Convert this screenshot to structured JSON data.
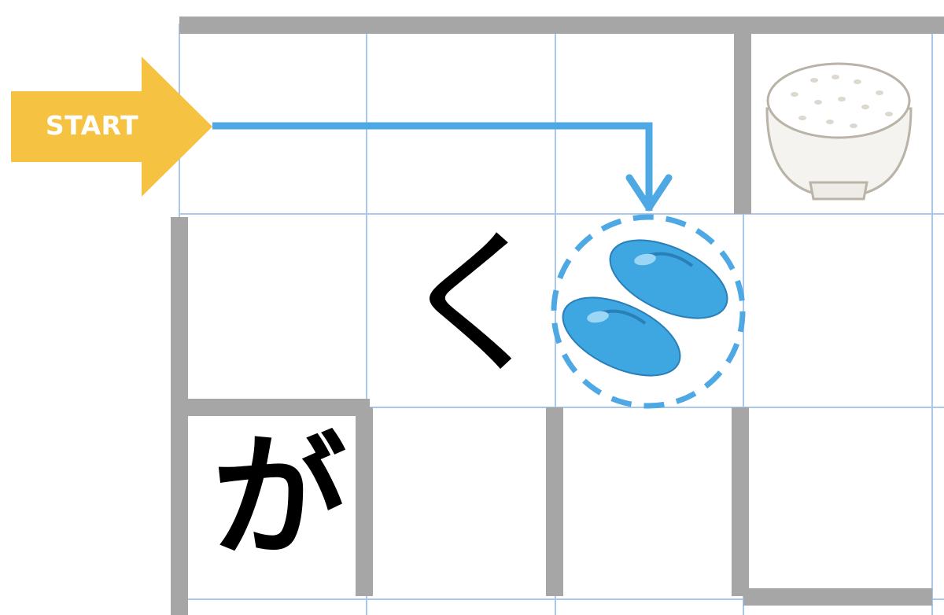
{
  "start": {
    "label": "START"
  },
  "cells": {
    "ku": {
      "char": "く"
    },
    "ga": {
      "char": "が"
    }
  },
  "icons": [
    "rice-bowl-icon",
    "slippers-icon",
    "start-arrow-icon"
  ],
  "colors": {
    "grid_line": "#aac8ec",
    "wall": "#a6a6a6",
    "path": "#4ea8e4",
    "start_arrow": "#f5c242",
    "slipper": "#3ea6e0",
    "text": "#000000"
  }
}
